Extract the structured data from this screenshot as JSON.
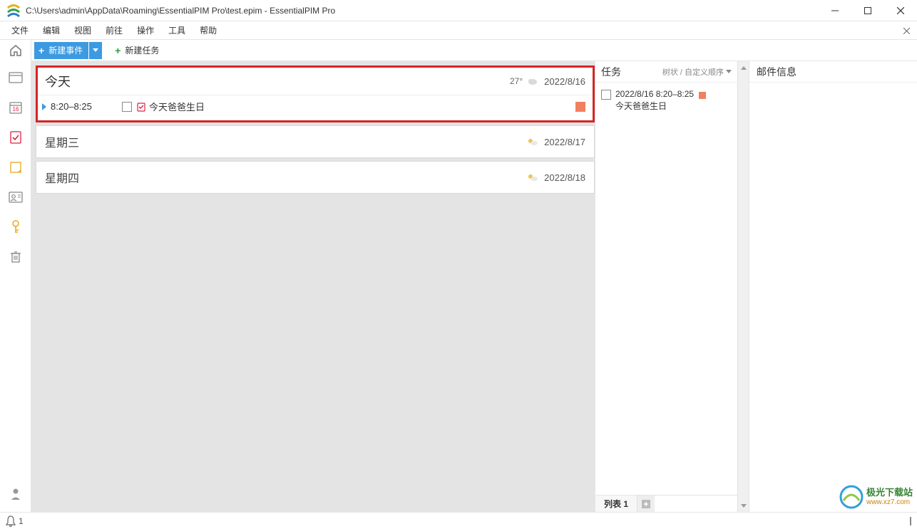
{
  "window": {
    "title": "C:\\Users\\admin\\AppData\\Roaming\\EssentialPIM Pro\\test.epim - EssentialPIM Pro"
  },
  "menu": {
    "items": [
      "文件",
      "编辑",
      "视图",
      "前往",
      "操作",
      "工具",
      "帮助"
    ]
  },
  "toolbar": {
    "new_event": "新建事件",
    "new_task": "新建任务"
  },
  "sidebar": {
    "calendar_day": "16"
  },
  "calendar": {
    "today": {
      "title": "今天",
      "temp": "27°",
      "date": "2022/8/16",
      "event": {
        "time": "8:20–8:25",
        "text": "今天爸爸生日"
      }
    },
    "days": [
      {
        "title": "星期三",
        "date": "2022/8/17"
      },
      {
        "title": "星期四",
        "date": "2022/8/18"
      }
    ]
  },
  "tasks": {
    "title": "任务",
    "sort_label": "树状 / 自定义顺序",
    "item": {
      "line1": "2022/8/16 8:20–8:25",
      "line2": "今天爸爸生日"
    },
    "tab": "列表 1"
  },
  "mail": {
    "title": "邮件信息"
  },
  "watermark": {
    "line1": "极光下载站",
    "line2": "www.xz7.com"
  },
  "statusbar": {
    "bell_count": "1"
  }
}
